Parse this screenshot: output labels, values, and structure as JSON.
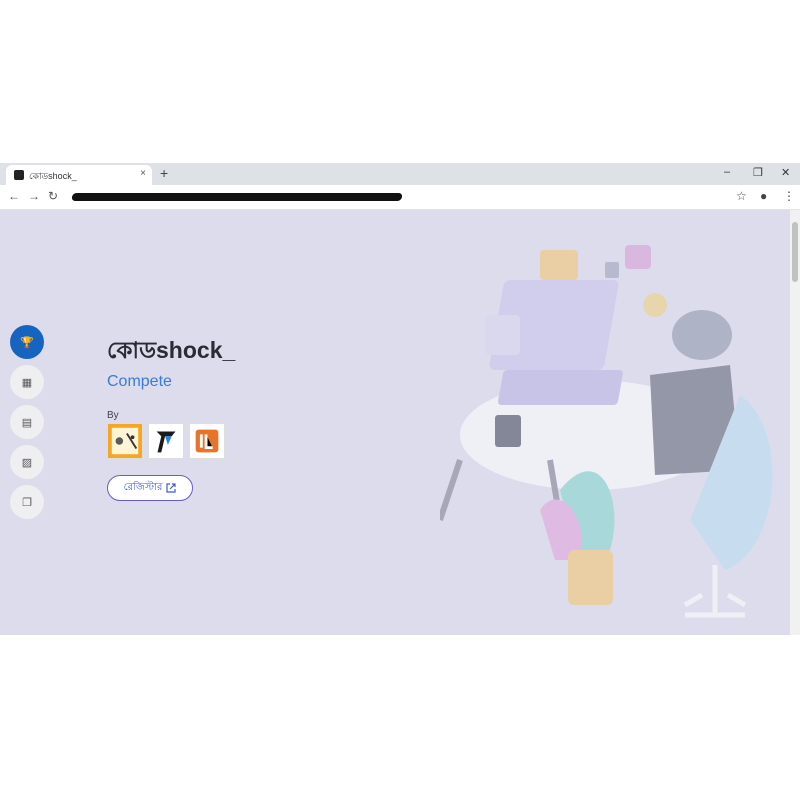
{
  "browser": {
    "tab_title": "কোডshock_",
    "tab_close": "×",
    "new_tab": "+",
    "window_controls": {
      "minimize": "–",
      "restore": "❐",
      "close": "✕"
    },
    "nav": {
      "back": "←",
      "forward": "→",
      "reload": "↻"
    },
    "toolbar_icons": {
      "bookmark": "☆",
      "profile": "●",
      "menu": "⋮"
    }
  },
  "page": {
    "logo": "কোডshock_",
    "heading": "Compete",
    "by_label": "By",
    "register_button": "রেজিস্টার",
    "sidebar": [
      {
        "icon": "trophy-icon",
        "glyph": "🏆",
        "active": true
      },
      {
        "icon": "calendar-icon",
        "glyph": "▦",
        "active": false
      },
      {
        "icon": "schedule-icon",
        "glyph": "▤",
        "active": false
      },
      {
        "icon": "gallery-icon",
        "glyph": "▨",
        "active": false
      },
      {
        "icon": "cards-icon",
        "glyph": "❐",
        "active": false
      }
    ],
    "organizers": [
      {
        "name": "organizer-logo-1",
        "color": "#f5a623"
      },
      {
        "name": "organizer-logo-2",
        "color": "#1a1a1a"
      },
      {
        "name": "organizer-logo-3",
        "color": "#e8732a"
      }
    ]
  },
  "colors": {
    "accent": "#1565c0",
    "page_bg": "#dcdcec",
    "link": "#3a7bd5"
  }
}
